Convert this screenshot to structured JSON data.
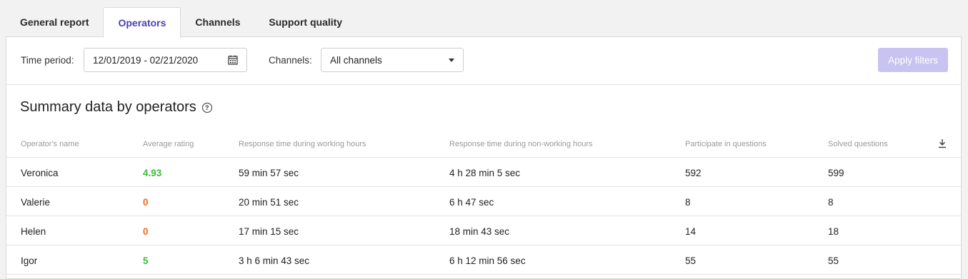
{
  "tabs": [
    {
      "label": "General report",
      "active": false
    },
    {
      "label": "Operators",
      "active": true
    },
    {
      "label": "Channels",
      "active": false
    },
    {
      "label": "Support quality",
      "active": false
    }
  ],
  "filters": {
    "time_period_label": "Time period:",
    "date_range": "12/01/2019 - 02/21/2020",
    "channels_label": "Channels:",
    "channels_value": "All channels",
    "apply_label": "Apply filters"
  },
  "summary": {
    "title": "Summary data by operators",
    "help_icon": "question-circle-icon"
  },
  "table": {
    "headers": [
      "Operator's name",
      "Average rating",
      "Response time during working hours",
      "Response time during non-working hours",
      "Participate in questions",
      "Solved questions"
    ],
    "rows": [
      {
        "name": "Veronica",
        "rating": "4.93",
        "rating_color": "#3dbb3d",
        "work": "59 min 57 sec",
        "nonwork": "4 h 28 min 5 sec",
        "participate": "592",
        "solved": "599"
      },
      {
        "name": "Valerie",
        "rating": "0",
        "rating_color": "#f06a1d",
        "work": "20 min 51 sec",
        "nonwork": "6 h 47 sec",
        "participate": "8",
        "solved": "8"
      },
      {
        "name": "Helen",
        "rating": "0",
        "rating_color": "#f06a1d",
        "work": "17 min 15 sec",
        "nonwork": "18 min 43 sec",
        "participate": "14",
        "solved": "18"
      },
      {
        "name": "Igor",
        "rating": "5",
        "rating_color": "#3dbb3d",
        "work": "3 h 6 min 43 sec",
        "nonwork": "6 h 12 min 56 sec",
        "participate": "55",
        "solved": "55"
      }
    ]
  },
  "colors": {
    "accent": "#4b3fb5",
    "apply_disabled": "#c8c3f0"
  }
}
